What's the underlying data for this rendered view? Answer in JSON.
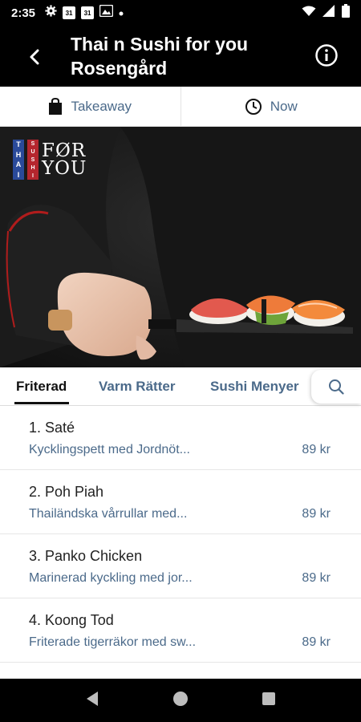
{
  "status_bar": {
    "time": "2:35",
    "calendar_day_1": "31",
    "calendar_day_2": "31",
    "icons": [
      "gear-icon",
      "calendar-icon",
      "calendar-icon",
      "image-icon",
      "dot-icon",
      "wifi-icon",
      "signal-icon",
      "battery-icon"
    ]
  },
  "header": {
    "title_line1": "Thai n Sushi for you",
    "title_line2": "Rosengård"
  },
  "order_options": {
    "takeaway": "Takeaway",
    "time": "Now"
  },
  "hero": {
    "logo_vertical_1": [
      "T",
      "H",
      "A",
      "I"
    ],
    "logo_vertical_2": [
      "S",
      "U",
      "S",
      "H",
      "I"
    ],
    "logo_text_line1": "FØR",
    "logo_text_line2": "YOU"
  },
  "tabs": [
    {
      "label": "Friterad",
      "active": true
    },
    {
      "label": "Varm Rätter",
      "active": false
    },
    {
      "label": "Sushi Menyer",
      "active": false
    }
  ],
  "menu_items": [
    {
      "name": "1. Saté",
      "description": "Kycklingspett med Jordnöt...",
      "price": "89 kr"
    },
    {
      "name": "2. Poh Piah",
      "description": "Thailändska vårrullar med...",
      "price": "89 kr"
    },
    {
      "name": "3. Panko Chicken",
      "description": "Marinerad kyckling med jor...",
      "price": "89 kr"
    },
    {
      "name": "4. Koong Tod",
      "description": "Friterade tigerräkor med sw...",
      "price": "89 kr"
    }
  ],
  "colors": {
    "accent_text": "#4b6a8a",
    "header_bg": "#000000"
  }
}
